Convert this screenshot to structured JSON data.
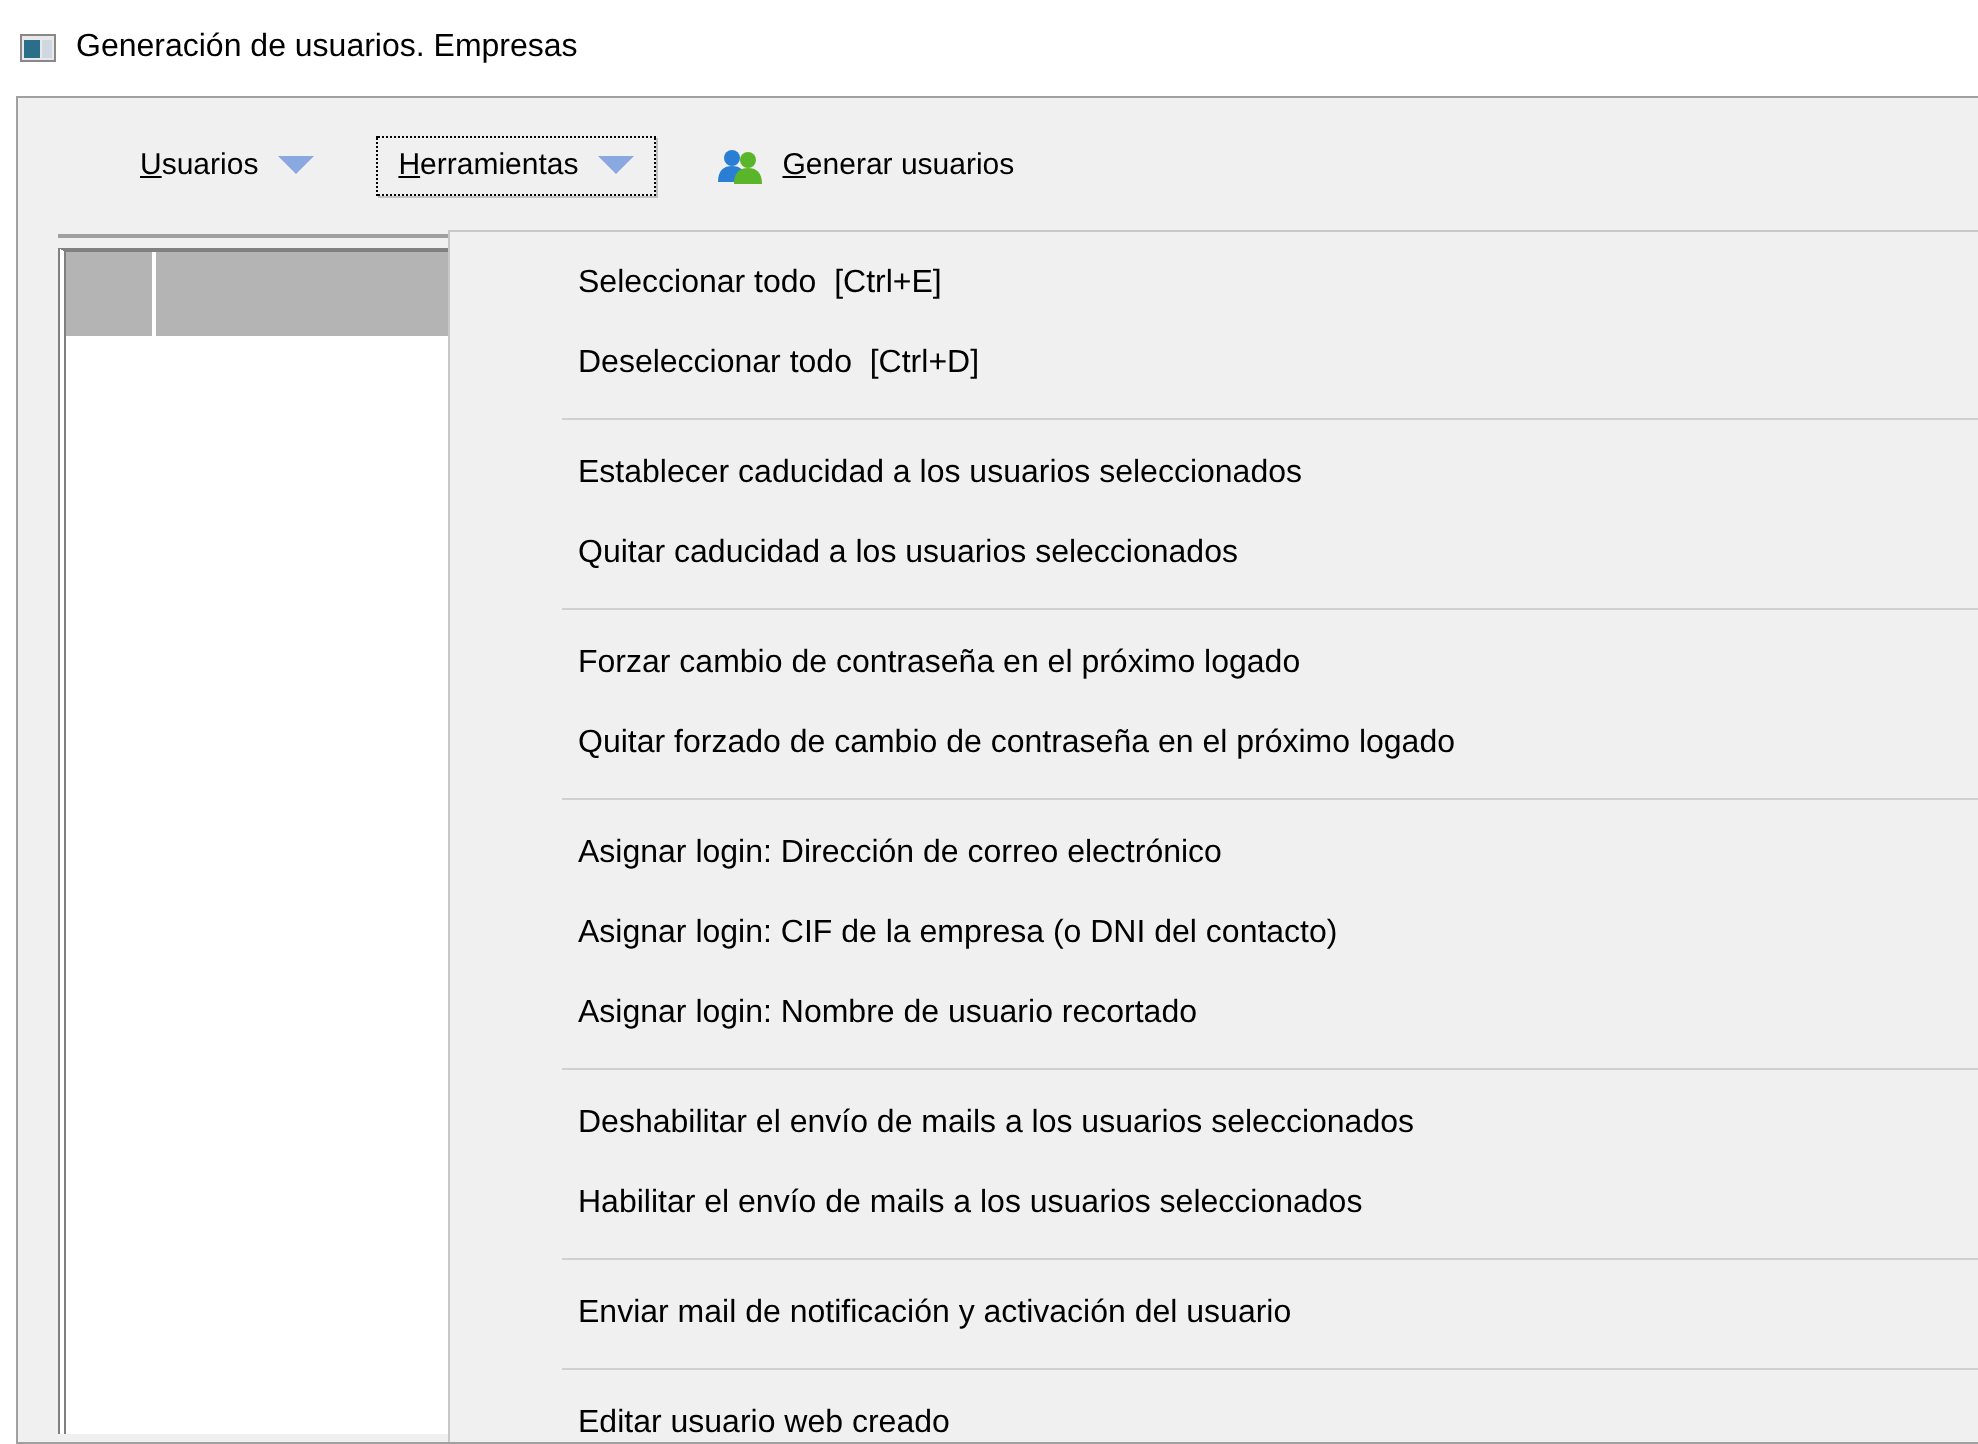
{
  "window": {
    "title": "Generación de usuarios. Empresas"
  },
  "toolbar": [
    {
      "kind": "dropdown",
      "label": "Usuarios",
      "mnemonic_underlined": true,
      "focused": false
    },
    {
      "kind": "dropdown",
      "label": "Herramientas",
      "mnemonic_underlined": true,
      "focused": true
    },
    {
      "kind": "action",
      "label": "Generar usuarios",
      "mnemonic_underlined": true,
      "focused": false
    }
  ],
  "menu": {
    "groups": [
      [
        "Seleccionar todo  [Ctrl+E]",
        "Deseleccionar todo  [Ctrl+D]"
      ],
      [
        "Establecer caducidad a los usuarios seleccionados",
        "Quitar caducidad a los usuarios seleccionados"
      ],
      [
        "Forzar cambio de contraseña en el próximo logado",
        "Quitar forzado de cambio de contraseña en el próximo logado"
      ],
      [
        "Asignar login: Dirección de correo electrónico",
        "Asignar login: CIF de la empresa (o DNI del contacto)",
        "Asignar login: Nombre de usuario recortado"
      ],
      [
        "Deshabilitar el envío de mails a los usuarios seleccionados",
        "Habilitar el envío de mails a los usuarios seleccionados"
      ],
      [
        "Enviar mail de notificación y activación del usuario"
      ],
      [
        "Editar usuario web creado"
      ]
    ]
  }
}
